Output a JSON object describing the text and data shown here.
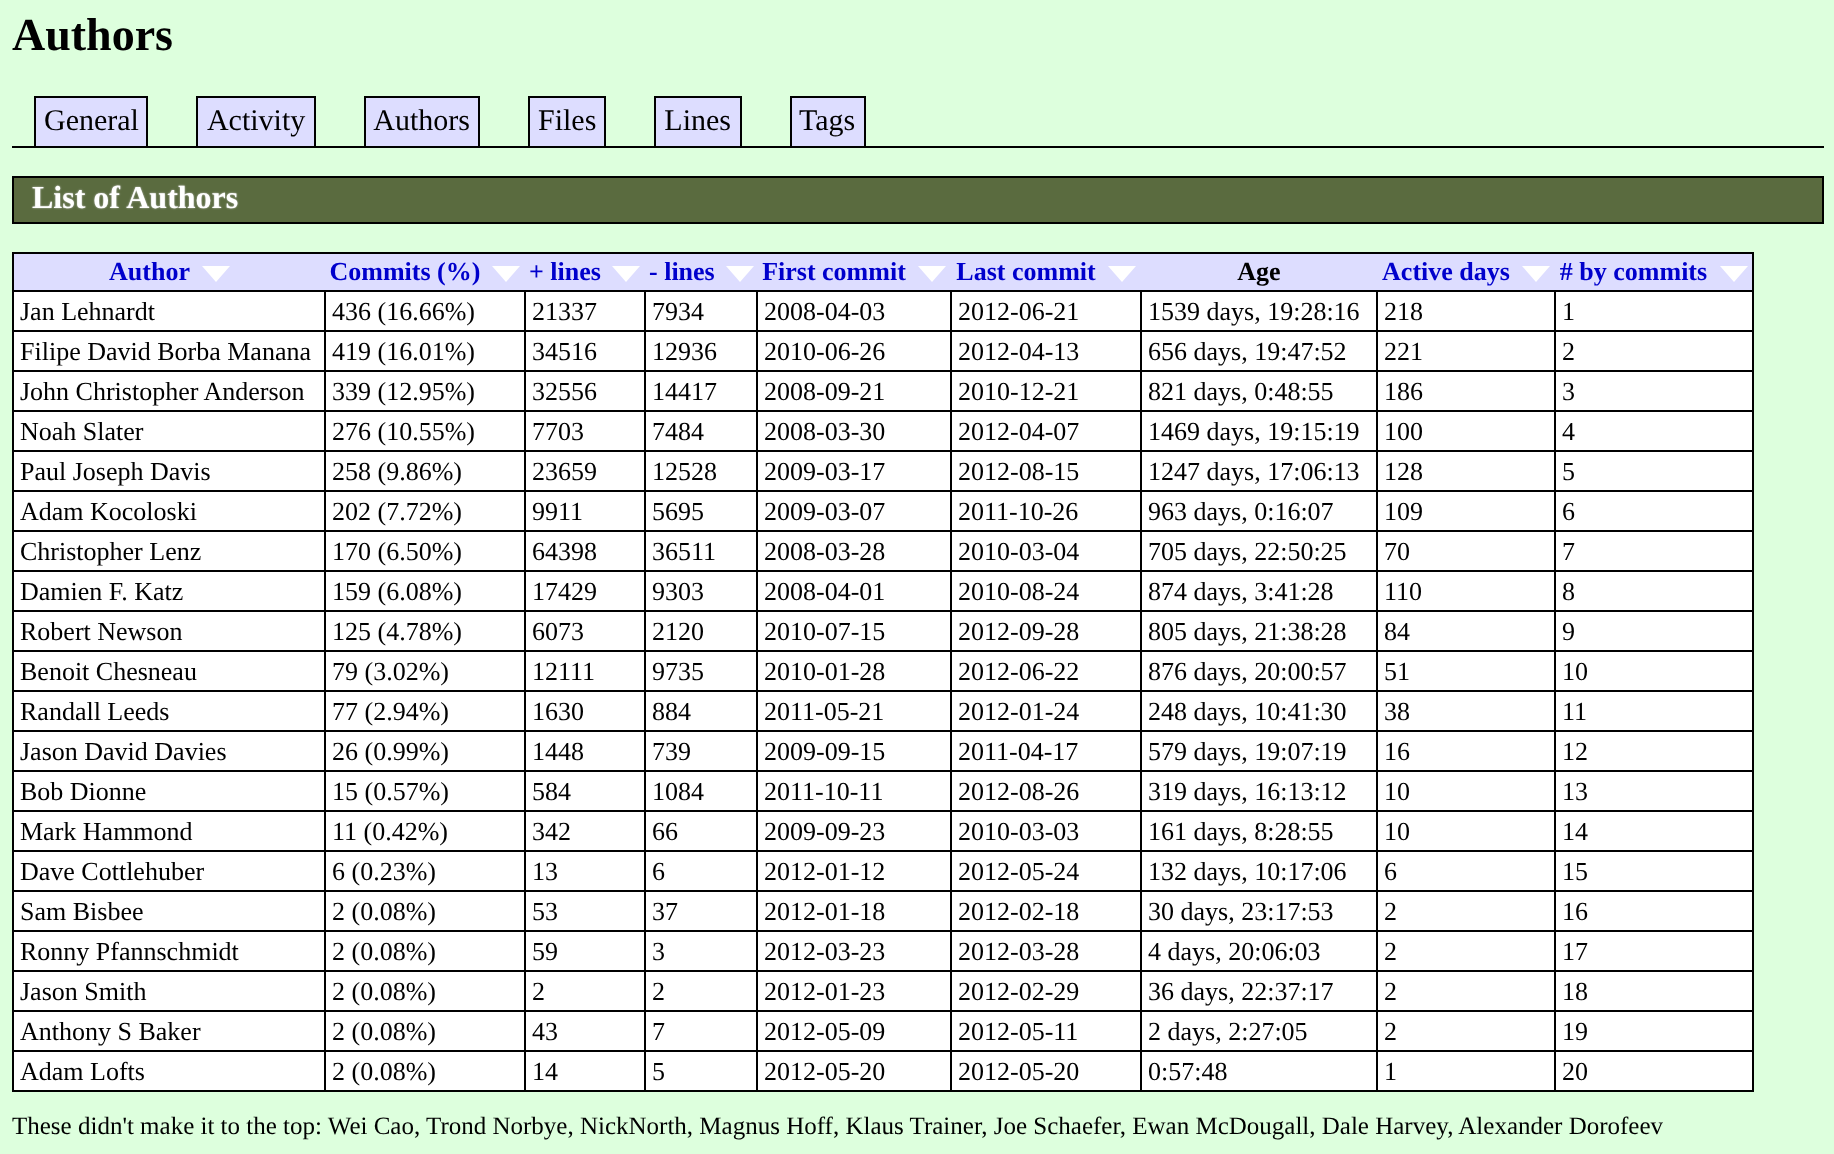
{
  "page": {
    "title": "Authors"
  },
  "tabs": [
    {
      "label": "General"
    },
    {
      "label": "Activity"
    },
    {
      "label": "Authors"
    },
    {
      "label": "Files"
    },
    {
      "label": "Lines"
    },
    {
      "label": "Tags"
    }
  ],
  "section": {
    "title": "List of Authors"
  },
  "table": {
    "columns": [
      {
        "label": "Author",
        "sortable": true
      },
      {
        "label": "Commits (%)",
        "sortable": true
      },
      {
        "label": "+ lines",
        "sortable": true
      },
      {
        "label": "- lines",
        "sortable": true
      },
      {
        "label": "First commit",
        "sortable": true
      },
      {
        "label": "Last commit",
        "sortable": true
      },
      {
        "label": "Age",
        "sortable": false
      },
      {
        "label": "Active days",
        "sortable": true
      },
      {
        "label": "# by commits",
        "sortable": true
      }
    ],
    "rows": [
      [
        "Jan Lehnardt",
        "436 (16.66%)",
        "21337",
        "7934",
        "2008-04-03",
        "2012-06-21",
        "1539 days, 19:28:16",
        "218",
        "1"
      ],
      [
        "Filipe David Borba Manana",
        "419 (16.01%)",
        "34516",
        "12936",
        "2010-06-26",
        "2012-04-13",
        "656 days, 19:47:52",
        "221",
        "2"
      ],
      [
        "John Christopher Anderson",
        "339 (12.95%)",
        "32556",
        "14417",
        "2008-09-21",
        "2010-12-21",
        "821 days, 0:48:55",
        "186",
        "3"
      ],
      [
        "Noah Slater",
        "276 (10.55%)",
        "7703",
        "7484",
        "2008-03-30",
        "2012-04-07",
        "1469 days, 19:15:19",
        "100",
        "4"
      ],
      [
        "Paul Joseph Davis",
        "258 (9.86%)",
        "23659",
        "12528",
        "2009-03-17",
        "2012-08-15",
        "1247 days, 17:06:13",
        "128",
        "5"
      ],
      [
        "Adam Kocoloski",
        "202 (7.72%)",
        "9911",
        "5695",
        "2009-03-07",
        "2011-10-26",
        "963 days, 0:16:07",
        "109",
        "6"
      ],
      [
        "Christopher Lenz",
        "170 (6.50%)",
        "64398",
        "36511",
        "2008-03-28",
        "2010-03-04",
        "705 days, 22:50:25",
        "70",
        "7"
      ],
      [
        "Damien F. Katz",
        "159 (6.08%)",
        "17429",
        "9303",
        "2008-04-01",
        "2010-08-24",
        "874 days, 3:41:28",
        "110",
        "8"
      ],
      [
        "Robert Newson",
        "125 (4.78%)",
        "6073",
        "2120",
        "2010-07-15",
        "2012-09-28",
        "805 days, 21:38:28",
        "84",
        "9"
      ],
      [
        "Benoit Chesneau",
        "79 (3.02%)",
        "12111",
        "9735",
        "2010-01-28",
        "2012-06-22",
        "876 days, 20:00:57",
        "51",
        "10"
      ],
      [
        "Randall Leeds",
        "77 (2.94%)",
        "1630",
        "884",
        "2011-05-21",
        "2012-01-24",
        "248 days, 10:41:30",
        "38",
        "11"
      ],
      [
        "Jason David Davies",
        "26 (0.99%)",
        "1448",
        "739",
        "2009-09-15",
        "2011-04-17",
        "579 days, 19:07:19",
        "16",
        "12"
      ],
      [
        "Bob Dionne",
        "15 (0.57%)",
        "584",
        "1084",
        "2011-10-11",
        "2012-08-26",
        "319 days, 16:13:12",
        "10",
        "13"
      ],
      [
        "Mark Hammond",
        "11 (0.42%)",
        "342",
        "66",
        "2009-09-23",
        "2010-03-03",
        "161 days, 8:28:55",
        "10",
        "14"
      ],
      [
        "Dave Cottlehuber",
        "6 (0.23%)",
        "13",
        "6",
        "2012-01-12",
        "2012-05-24",
        "132 days, 10:17:06",
        "6",
        "15"
      ],
      [
        "Sam Bisbee",
        "2 (0.08%)",
        "53",
        "37",
        "2012-01-18",
        "2012-02-18",
        "30 days, 23:17:53",
        "2",
        "16"
      ],
      [
        "Ronny Pfannschmidt",
        "2 (0.08%)",
        "59",
        "3",
        "2012-03-23",
        "2012-03-28",
        "4 days, 20:06:03",
        "2",
        "17"
      ],
      [
        "Jason Smith",
        "2 (0.08%)",
        "2",
        "2",
        "2012-01-23",
        "2012-02-29",
        "36 days, 22:37:17",
        "2",
        "18"
      ],
      [
        "Anthony S Baker",
        "2 (0.08%)",
        "43",
        "7",
        "2012-05-09",
        "2012-05-11",
        "2 days, 2:27:05",
        "2",
        "19"
      ],
      [
        "Adam Lofts",
        "2 (0.08%)",
        "14",
        "5",
        "2012-05-20",
        "2012-05-20",
        "0:57:48",
        "1",
        "20"
      ]
    ]
  },
  "footer": "These didn't make it to the top: Wei Cao, Trond Norbye, NickNorth, Magnus Hoff, Klaus Trainer, Joe Schaefer, Ewan McDougall, Dale Harvey, Alexander Dorofeev"
}
